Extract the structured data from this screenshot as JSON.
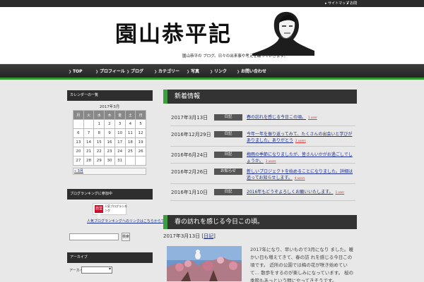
{
  "topbar": {
    "links": [
      "サイトマップ",
      "お問"
    ]
  },
  "header": {
    "logo": "園山恭平記",
    "tagline": "園山恭平の ブログ。日々の出来事や考えを綴っていきます。"
  },
  "nav": {
    "items": [
      "TOP",
      "プロフィール",
      "ブログ",
      "カテゴリー",
      "写真",
      "リンク",
      "お問い合わせ"
    ]
  },
  "sidebar": {
    "calendar_heading": "カレンダーの一覧",
    "calendar_caption": "2017年3月",
    "weekdays": [
      "月",
      "火",
      "水",
      "木",
      "金",
      "土",
      "日"
    ],
    "weeks": [
      [
        "",
        "",
        "1",
        "2",
        "3",
        "4",
        "5"
      ],
      [
        "6",
        "7",
        "8",
        "9",
        "10",
        "11",
        "12"
      ],
      [
        "13",
        "14",
        "15",
        "16",
        "17",
        "18",
        "19"
      ],
      [
        "20",
        "21",
        "22",
        "23",
        "24",
        "25",
        "26"
      ],
      [
        "27",
        "28",
        "29",
        "30",
        "31",
        "",
        ""
      ]
    ],
    "prev_month": "« 3月",
    "ranking_heading": "ブログランキングに参加中",
    "ranking_badge_icon": "自営業",
    "ranking_badge_text": "人気ブログランキング",
    "ranking_link": "人気ブログランキングへのリンクはこちらからです",
    "search_button": "検索",
    "archive_heading": "アーカイブ",
    "archive_label": "アーカイブ"
  },
  "news": {
    "heading": "新着情報",
    "rows": [
      {
        "date": "2017年3月13日",
        "category": "日記",
        "title": "春の訪れを感じる今日この頃。",
        "users": "1 user"
      },
      {
        "date": "2016年12月29日",
        "category": "日記",
        "title": "今年一年を振り返ってみて、たくさんの出会いと学びがありました。ありがとう",
        "users": "2 users"
      },
      {
        "date": "2016年6月24日",
        "category": "日記",
        "title": "梅雨の季節になりましたが、皆さんいかがお過ごしでしょうか。",
        "users": "3 users"
      },
      {
        "date": "2016年2月26日",
        "category": "お知らせ",
        "title": "新しいプロジェクトを始めることになりました。詳細は追ってお知らせします。",
        "users": "4 users"
      },
      {
        "date": "2016年1月10日",
        "category": "日記",
        "title": "2016年もどうぞよろしくお願いいたします。",
        "users": "1 user"
      }
    ]
  },
  "post": {
    "heading": "春の訪れを感じる今日この頃。",
    "date": "2017年3月13日",
    "category": "日記",
    "body": "2017年になり、早いもので3月になり ました。暖かい日も増えてきて、春の訪 れを感じる今日この頃です。 近所の公園では梅の花が咲き始めていて… 散歩をするのが楽しみになっています。 桜の季節もあっという間にやってきそうです。"
  }
}
